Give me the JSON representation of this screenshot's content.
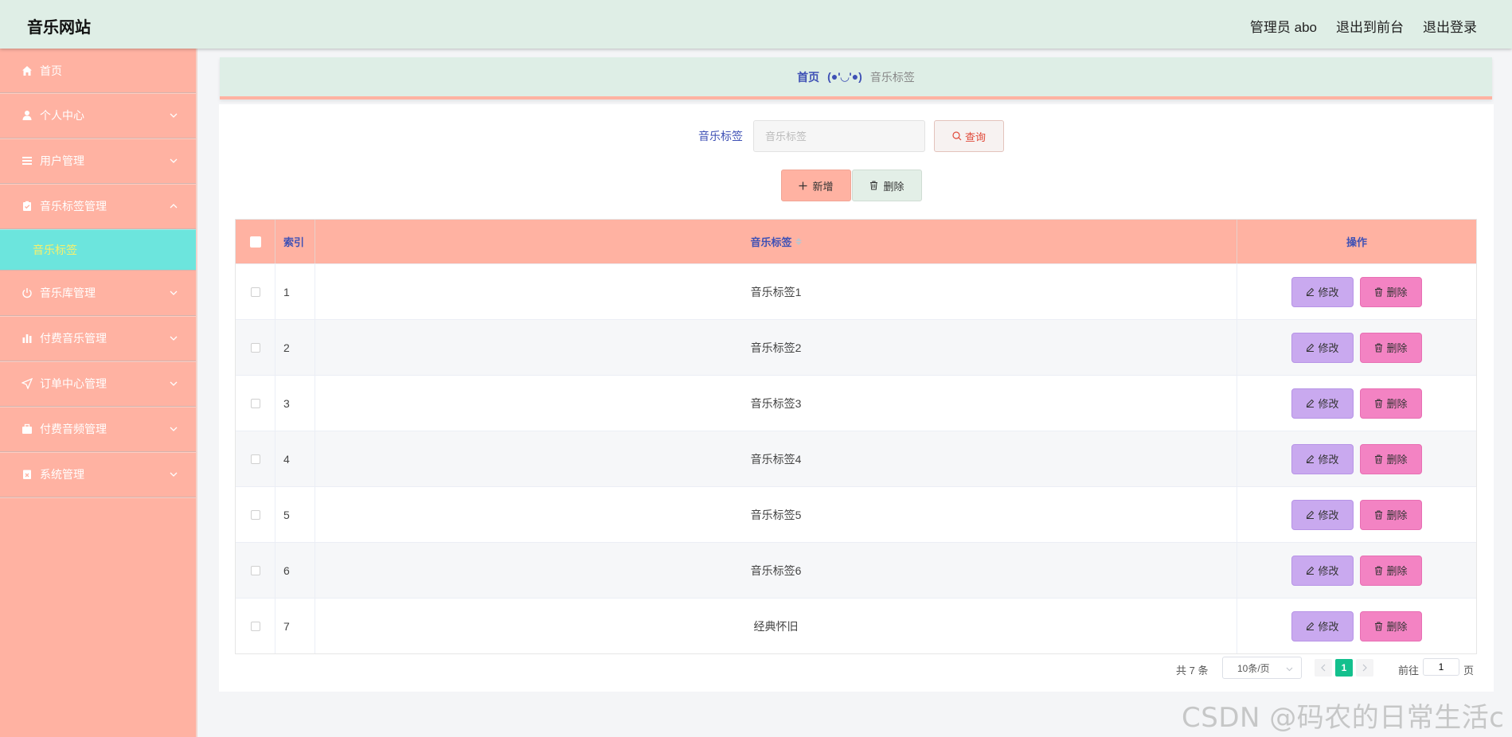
{
  "header": {
    "title": "音乐网站",
    "user": "管理员 abo",
    "to_front": "退出到前台",
    "logout": "退出登录"
  },
  "sidebar": {
    "items": [
      {
        "label": "首页",
        "icon": "home-icon"
      },
      {
        "label": "个人中心",
        "icon": "user-icon"
      },
      {
        "label": "用户管理",
        "icon": "list-icon"
      },
      {
        "label": "音乐标签管理",
        "icon": "clipboard-check-icon"
      },
      {
        "label": "音乐库管理",
        "icon": "power-icon"
      },
      {
        "label": "付费音乐管理",
        "icon": "bar-chart-icon"
      },
      {
        "label": "订单中心管理",
        "icon": "send-icon"
      },
      {
        "label": "付费音频管理",
        "icon": "briefcase-icon"
      },
      {
        "label": "系统管理",
        "icon": "document-x-icon"
      }
    ],
    "active_sub": "音乐标签"
  },
  "breadcrumb": {
    "home": "首页",
    "face": "(●'◡'●)",
    "current": "音乐标签"
  },
  "search": {
    "label": "音乐标签",
    "placeholder": "音乐标签",
    "query_label": "查询"
  },
  "actions": {
    "add_label": "新增",
    "delete_label": "删除"
  },
  "table": {
    "columns": {
      "index": "索引",
      "tag": "音乐标签",
      "ops": "操作"
    },
    "edit_label": "修改",
    "delete_label": "删除",
    "rows": [
      {
        "index": "1",
        "tag": "音乐标签1"
      },
      {
        "index": "2",
        "tag": "音乐标签2"
      },
      {
        "index": "3",
        "tag": "音乐标签3"
      },
      {
        "index": "4",
        "tag": "音乐标签4"
      },
      {
        "index": "5",
        "tag": "音乐标签5"
      },
      {
        "index": "6",
        "tag": "音乐标签6"
      },
      {
        "index": "7",
        "tag": "经典怀旧"
      }
    ]
  },
  "pagination": {
    "total": "共 7 条",
    "page_size": "10条/页",
    "current": "1",
    "goto": "前往",
    "goto_value": "1",
    "page_suffix": "页"
  },
  "watermark": "CSDN @码农的日常生活c",
  "colors": {
    "header_bg": "#dfeee6",
    "sidebar_bg": "#ffb2a2",
    "submenu_active_bg": "#6ce5dd",
    "submenu_active_text": "#f8f06a",
    "edit_btn": "#c9a9ef",
    "delete_btn": "#f383c3",
    "page_active": "#13c08d",
    "accent_text": "#3f51b5"
  }
}
